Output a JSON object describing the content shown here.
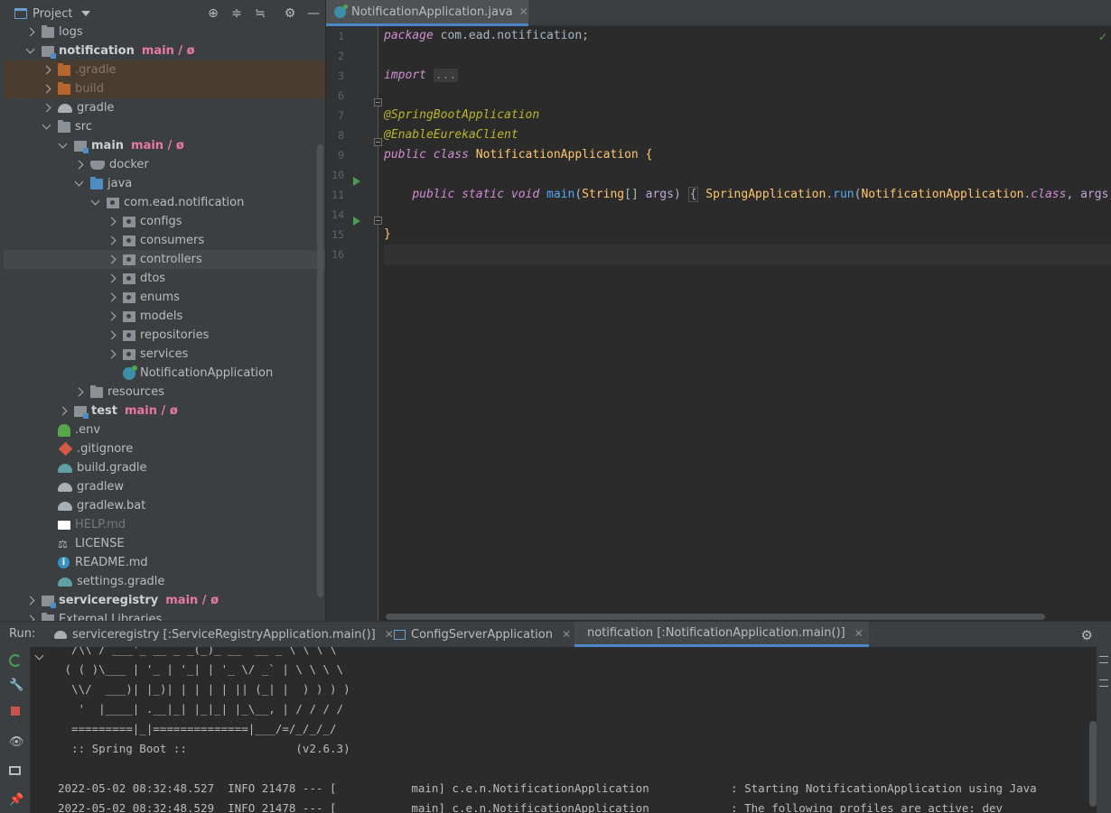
{
  "project_panel": {
    "title": "Project",
    "header_icons": [
      "locate-icon",
      "expand-all-icon",
      "collapse-all-icon",
      "gear-icon",
      "minimize-icon"
    ],
    "tree": [
      {
        "label": "logs",
        "icon": "folder-grey",
        "arrow": "right",
        "indent": 1
      },
      {
        "label": "notification",
        "branch": "main / ø",
        "icon": "module",
        "arrow": "down",
        "indent": 1,
        "bold": true
      },
      {
        "label": ".gradle",
        "icon": "folder-orange",
        "arrow": "right",
        "indent": 2,
        "style": "excluded"
      },
      {
        "label": "build",
        "icon": "folder-orange",
        "arrow": "right",
        "indent": 2,
        "style": "excluded"
      },
      {
        "label": "gradle",
        "icon": "gradle-grey",
        "arrow": "right",
        "indent": 2
      },
      {
        "label": "src",
        "icon": "folder-grey",
        "arrow": "down",
        "indent": 2
      },
      {
        "label": "main",
        "branch": "main / ø",
        "icon": "module",
        "arrow": "down",
        "indent": 3,
        "bold": true
      },
      {
        "label": "docker",
        "icon": "docker",
        "arrow": "right",
        "indent": 4
      },
      {
        "label": "java",
        "icon": "folder-blue",
        "arrow": "down",
        "indent": 4
      },
      {
        "label": "com.ead.notification",
        "icon": "package",
        "arrow": "down",
        "indent": 5
      },
      {
        "label": "configs",
        "icon": "package",
        "arrow": "right",
        "indent": 6
      },
      {
        "label": "consumers",
        "icon": "package",
        "arrow": "right",
        "indent": 6
      },
      {
        "label": "controllers",
        "icon": "package",
        "arrow": "right",
        "indent": 6,
        "style": "selected"
      },
      {
        "label": "dtos",
        "icon": "package",
        "arrow": "right",
        "indent": 6
      },
      {
        "label": "enums",
        "icon": "package",
        "arrow": "right",
        "indent": 6
      },
      {
        "label": "models",
        "icon": "package",
        "arrow": "right",
        "indent": 6
      },
      {
        "label": "repositories",
        "icon": "package",
        "arrow": "right",
        "indent": 6
      },
      {
        "label": "services",
        "icon": "package",
        "arrow": "right",
        "indent": 6
      },
      {
        "label": "NotificationApplication",
        "icon": "class",
        "arrow": "none",
        "indent": 6
      },
      {
        "label": "resources",
        "icon": "folder-grey",
        "arrow": "right",
        "indent": 4
      },
      {
        "label": "test",
        "branch": "main / ø",
        "icon": "module",
        "arrow": "right",
        "indent": 3,
        "bold": true
      },
      {
        "label": ".env",
        "icon": "tree-green",
        "arrow": "none",
        "indent": 2
      },
      {
        "label": ".gitignore",
        "icon": "git",
        "arrow": "none",
        "indent": 2
      },
      {
        "label": "build.gradle",
        "icon": "gradle",
        "arrow": "none",
        "indent": 2
      },
      {
        "label": "gradlew",
        "icon": "gradle-grey",
        "arrow": "none",
        "indent": 2
      },
      {
        "label": "gradlew.bat",
        "icon": "gradle-grey",
        "arrow": "none",
        "indent": 2
      },
      {
        "label": "HELP.md",
        "icon": "md",
        "arrow": "none",
        "indent": 2,
        "style": "dimgrey"
      },
      {
        "label": "LICENSE",
        "icon": "license",
        "arrow": "none",
        "indent": 2
      },
      {
        "label": "README.md",
        "icon": "info",
        "arrow": "none",
        "indent": 2
      },
      {
        "label": "settings.gradle",
        "icon": "gradle",
        "arrow": "none",
        "indent": 2
      },
      {
        "label": "serviceregistry",
        "branch": "main / ø",
        "icon": "module",
        "arrow": "right",
        "indent": 1,
        "bold": true
      },
      {
        "label": "External Libraries",
        "icon": "folder-grey",
        "arrow": "right",
        "indent": 1
      }
    ]
  },
  "editor": {
    "tab_label": "NotificationApplication.java",
    "lines": [
      {
        "n": "1",
        "html": "<span class=\"pink-kw\">package</span> <span class=\"pkg\">com.ead.notification;</span>"
      },
      {
        "n": "2",
        "html": ""
      },
      {
        "n": "3",
        "html": "<span class=\"pink-kw\">import</span> <span class=\"fold-dots\">...</span>"
      },
      {
        "n": "6",
        "html": ""
      },
      {
        "n": "7",
        "html": "<span class=\"ann\">@SpringBootApplication</span>"
      },
      {
        "n": "8",
        "html": "<span class=\"ann\">@EnableEurekaClient</span>"
      },
      {
        "n": "9",
        "html": "<span class=\"pink-kw\">public class</span> <span class=\"fn\">NotificationApplication</span> <span class=\"fn\">{</span>"
      },
      {
        "n": "10",
        "html": ""
      },
      {
        "n": "11",
        "html": "    <span class=\"pink-kw\">public static void</span> <span style=\"color:#56a8f5\">main</span>(<span class=\"fn\">String</span>[] <span style=\"color:#c0a5d8\">args</span>) <span class=\"hint-brace\">{</span> <span class=\"fn\">SpringApplication</span>.<span style=\"color:#56a8f5\">run</span>(<span class=\"fn\">NotificationApplication</span>.<span class=\"pink-kw\">class</span>, <span style=\"color:#c0a5d8\">args</span>); }"
      },
      {
        "n": "14",
        "html": ""
      },
      {
        "n": "15",
        "html": "<span class=\"fn\">}</span>"
      },
      {
        "n": "16",
        "html": ""
      }
    ]
  },
  "run_panel": {
    "label": "Run:",
    "tabs": [
      {
        "label": "serviceregistry [:ServiceRegistryApplication.main()]",
        "icon": "elephant"
      },
      {
        "label": "ConfigServerApplication",
        "icon": "config"
      },
      {
        "label": "notification [:NotificationApplication.main()]",
        "icon": "elephant",
        "active": true
      }
    ],
    "console_lines": [
      "  /\\\\ / ___'_ __ _ _(_)_ __  __ _ \\ \\ \\ \\",
      " ( ( )\\___ | '_ | '_| | '_ \\/ _` | \\ \\ \\ \\",
      "  \\\\/  ___)| |_)| | | | | || (_| |  ) ) ) )",
      "   '  |____| .__|_| |_|_| |_\\__, | / / / /",
      "  =========|_|==============|___/=/_/_/_/",
      "  :: Spring Boot ::                (v2.6.3)",
      "",
      "2022-05-02 08:32:48.527  INFO 21478 --- [           main] c.e.n.NotificationApplication            : Starting NotificationApplication using Java",
      "2022-05-02 08:32:48.529  INFO 21478 --- [           main] c.e.n.NotificationApplication            : The following profiles are active: dev"
    ]
  }
}
